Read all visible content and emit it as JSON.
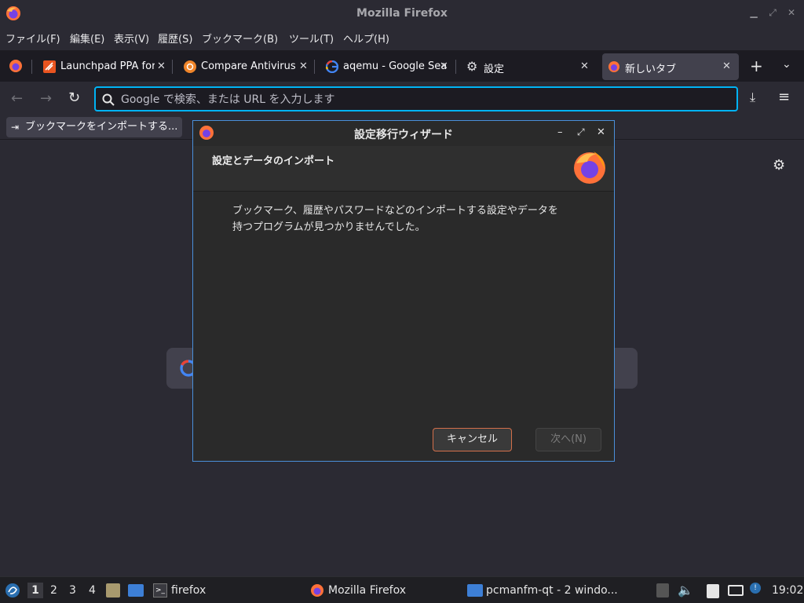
{
  "window": {
    "title": "Mozilla Firefox"
  },
  "menubar": [
    "ファイル(F)",
    "編集(E)",
    "表示(V)",
    "履歴(S)",
    "ブックマーク(B)",
    "ツール(T)",
    "ヘルプ(H)"
  ],
  "tabs": [
    {
      "label": "Launchpad PPA for",
      "icon": "launchpad-icon"
    },
    {
      "label": "Compare Antivirus",
      "icon": "ubuntu-icon"
    },
    {
      "label": "aqemu - Google Sea",
      "icon": "google-icon"
    },
    {
      "label": "設定",
      "icon": "gear-icon"
    },
    {
      "label": "新しいタブ",
      "icon": "firefox-icon",
      "active": true
    }
  ],
  "urlbar": {
    "placeholder": "Google で検索、または URL を入力します"
  },
  "bookmarks": {
    "import_label": "ブックマークをインポートする..."
  },
  "dialog": {
    "title": "設定移行ウィザード",
    "header": "設定とデータのインポート",
    "body_line1": "ブックマーク、履歴やパスワードなどのインポートする設定やデータを",
    "body_line2": "持つプログラムが見つかりませんでした。",
    "cancel_label": "キャンセル",
    "next_label": "次へ(N)"
  },
  "taskbar": {
    "workspaces": [
      "1",
      "2",
      "3",
      "4"
    ],
    "active_workspace": "1",
    "terminal_label": "firefox",
    "firefox_window": "Mozilla Firefox",
    "files_window": "pcmanfm-qt - 2 windo...",
    "clock": "19:02"
  },
  "colors": {
    "accent": "#00b3f4",
    "dialog_border": "#4a8fd9",
    "cancel_border": "#d36f4a"
  }
}
